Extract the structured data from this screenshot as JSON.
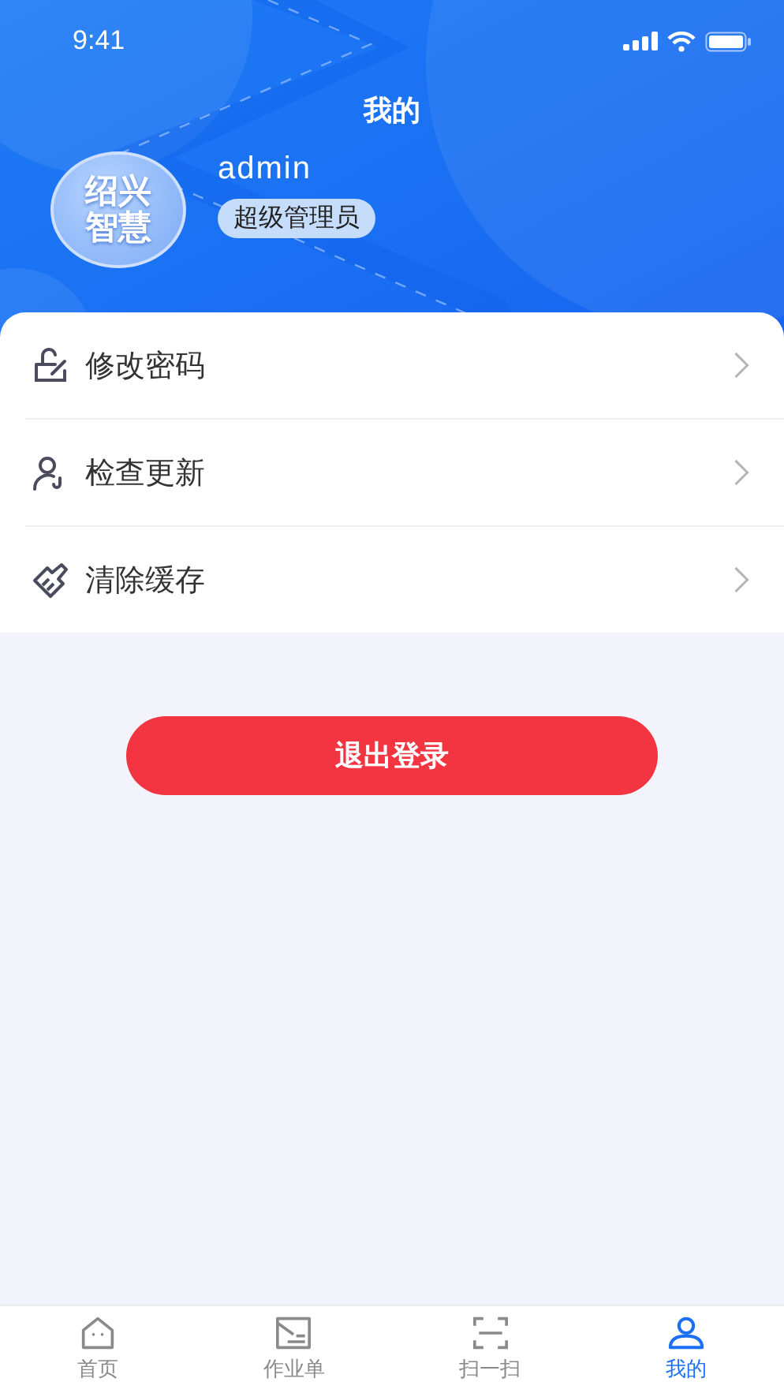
{
  "status_bar": {
    "time": "9:41"
  },
  "header": {
    "title": "我的"
  },
  "profile": {
    "logo_lines": [
      "绍兴",
      "智慧"
    ],
    "username": "admin",
    "role": "超级管理员"
  },
  "menu": [
    {
      "kind": "password",
      "label": "修改密码"
    },
    {
      "kind": "update",
      "label": "检查更新"
    },
    {
      "kind": "clear",
      "label": "清除缓存"
    }
  ],
  "logout_button": "退出登录",
  "tab_bar": [
    {
      "kind": "home",
      "label": "首页",
      "selected": false
    },
    {
      "kind": "orders",
      "label": "作业单",
      "selected": false
    },
    {
      "kind": "scan",
      "label": "扫一扫",
      "selected": false
    },
    {
      "kind": "profile",
      "label": "我的",
      "selected": true
    }
  ]
}
